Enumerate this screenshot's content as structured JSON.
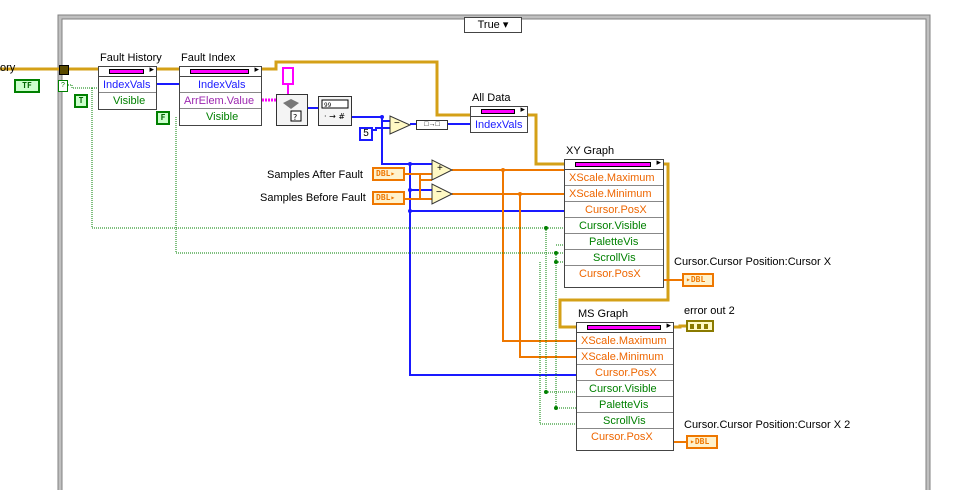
{
  "case_selector": {
    "value": "True",
    "arrows": "◂ ▾▸"
  },
  "left_edge_label": "ory",
  "left_bool_label": "TF",
  "fault_history": {
    "title": "Fault History",
    "rows": [
      "IndexVals",
      "Visible"
    ]
  },
  "fault_index": {
    "title": "Fault Index",
    "rows": [
      "IndexVals",
      "ArrElem.Value",
      "Visible"
    ]
  },
  "true_const": "T",
  "false_const": "F",
  "all_data": {
    "title": "All Data",
    "rows": [
      "IndexVals"
    ]
  },
  "numeric_const": "5",
  "build_array_label": "□→□",
  "samples_after": {
    "label": "Samples After Fault",
    "type": "DBL"
  },
  "samples_before": {
    "label": "Samples Before Fault",
    "type": "DBL"
  },
  "add_symbol": "+",
  "sub_symbol": "−",
  "sub_symbol2": "−",
  "xy_graph": {
    "title": "XY Graph",
    "rows": [
      "XScale.Maximum",
      "XScale.Minimum",
      "Cursor.PosX",
      "Cursor.Visible",
      "PaletteVis",
      "ScrollVis",
      "Cursor.PosX"
    ]
  },
  "ms_graph": {
    "title": "MS Graph",
    "rows": [
      "XScale.Maximum",
      "XScale.Minimum",
      "Cursor.PosX",
      "Cursor.Visible",
      "PaletteVis",
      "ScrollVis",
      "Cursor.PosX"
    ]
  },
  "cursor_out1": {
    "label": "Cursor.Cursor Position:Cursor X",
    "type": "DBL"
  },
  "cursor_out2": {
    "label": "Cursor.Cursor Position:Cursor X 2",
    "type": "DBL"
  },
  "error_out": {
    "label": "error out 2"
  },
  "colors": {
    "int_wire": "#1a1aff",
    "dbl_wire": "#ee7700",
    "bool_wire": "#008000",
    "cluster_wire": "#d4a017",
    "array_wire": "#ff00ff"
  }
}
